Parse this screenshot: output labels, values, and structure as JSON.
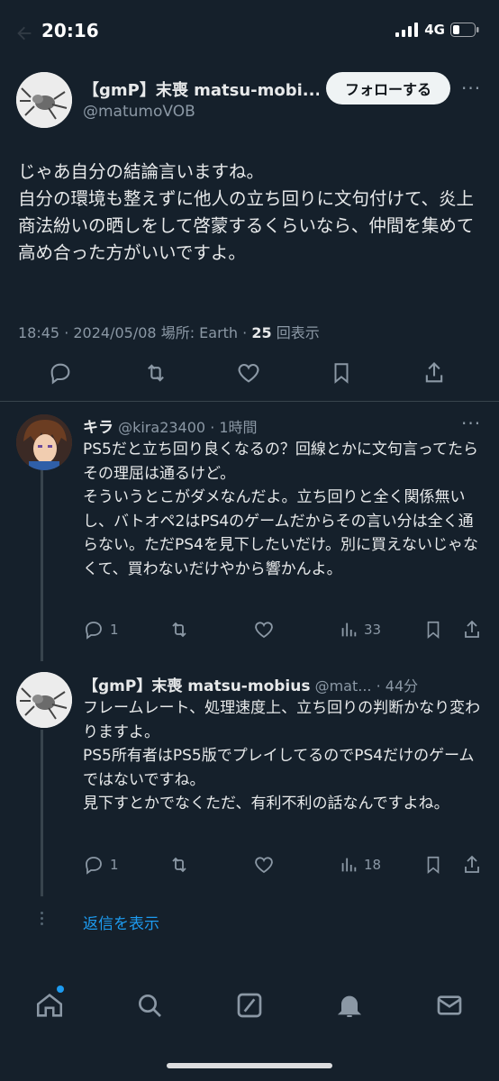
{
  "status_bar": {
    "time": "20:16",
    "network": "4G"
  },
  "main_tweet": {
    "display_name": "【gmP】末喪 matsu-mobi...",
    "handle": "@matumoVOB",
    "follow_label": "フォローする",
    "text": "じゃあ自分の結論言いますね。\n自分の環境も整えずに他人の立ち回りに文句付けて、炎上商法紛いの晒しをして啓蒙するくらいなら、仲間を集めて高め合った方がいいですよ。",
    "time": "18:45",
    "date": "2024/05/08",
    "location": "場所: Earth",
    "views_count": "25",
    "views_label": "回表示"
  },
  "replies": [
    {
      "display_name": "キラ",
      "handle": "@kira23400",
      "age": "1時間",
      "text": "PS5だと立ち回り良くなるの？回線とかに文句言ってたらその理屈は通るけど。\nそういうとこがダメなんだよ。立ち回りと全く関係無いし、バトオペ2はPS4のゲームだからその言い分は全く通らない。ただPS4を見下したいだけ。別に買えないじゃなくて、買わないだけやから響かんよ。",
      "reply_count": "1",
      "views": "33"
    },
    {
      "display_name": "【gmP】末喪 matsu-mobius",
      "handle": "@mat...",
      "age": "44分",
      "text": "フレームレート、処理速度上、立ち回りの判断かなり変わりますよ。\nPS5所有者はPS5版でプレイしてるのでPS4だけのゲームではないですね。\n見下すとかでなくただ、有利不利の話なんですよね。",
      "reply_count": "1",
      "views": "18"
    }
  ],
  "show_replies_label": "返信を表示",
  "tabs": [
    "home-icon",
    "search-icon",
    "grok-icon",
    "notifications-icon",
    "messages-icon"
  ],
  "colors": {
    "background": "#15202b",
    "accent": "#1d9bf0",
    "muted": "#8b98a5"
  }
}
